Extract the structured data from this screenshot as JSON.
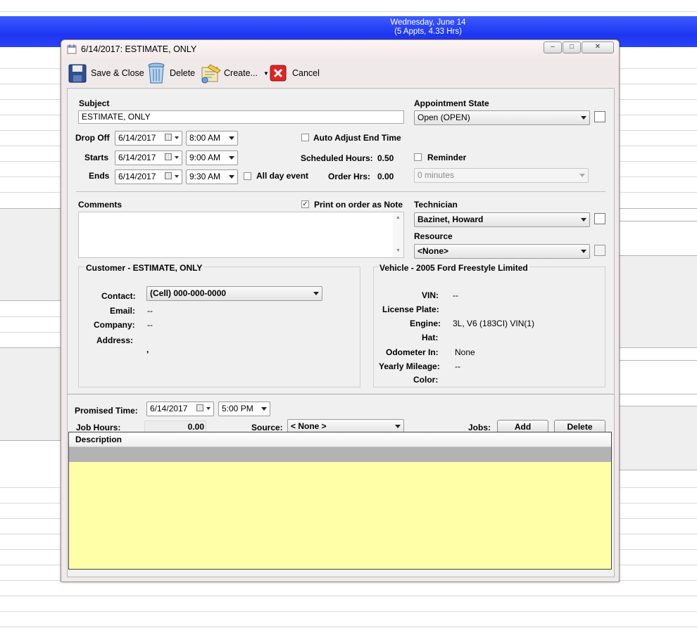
{
  "calendar": {
    "day_heading": "Wednesday, June 14",
    "day_summary": "(5 Appts, 4.33 Hrs)"
  },
  "window": {
    "title": "6/14/2017: ESTIMATE, ONLY",
    "min": "–",
    "max": "□",
    "close": "✕"
  },
  "toolbar": {
    "save_close": "Save & Close",
    "delete": "Delete",
    "create": "Create...",
    "cancel": "Cancel"
  },
  "form": {
    "subject_label": "Subject",
    "subject_value": "ESTIMATE, ONLY",
    "appt_state_label": "Appointment State",
    "appt_state_value": "Open (OPEN)",
    "dropoff_label": "Drop Off",
    "dropoff_date": "6/14/2017",
    "dropoff_time": "8:00 AM",
    "auto_adjust_label": "Auto Adjust End Time",
    "starts_label": "Starts",
    "starts_date": "6/14/2017",
    "starts_time": "9:00 AM",
    "sched_hours_label": "Scheduled Hours:",
    "sched_hours_value": "0.50",
    "reminder_label": "Reminder",
    "ends_label": "Ends",
    "ends_date": "6/14/2017",
    "ends_time": "9:30 AM",
    "all_day_label": "All day event",
    "order_hrs_label": "Order Hrs:",
    "order_hrs_value": "0.00",
    "reminder_value": "0 minutes",
    "comments_label": "Comments",
    "print_note_label": "Print on order as Note",
    "check_mark": "✓",
    "technician_label": "Technician",
    "technician_value": "Bazinet, Howard",
    "resource_label": "Resource",
    "resource_value": "<None>"
  },
  "customer": {
    "heading": "Customer - ESTIMATE, ONLY",
    "contact_label": "Contact:",
    "contact_value": "(Cell)  000-000-0000",
    "email_label": "Email:",
    "email_value": "--",
    "company_label": "Company:",
    "company_value": "--",
    "address_label": "Address:",
    "address_value": ","
  },
  "vehicle": {
    "heading": "Vehicle - 2005 Ford Freestyle Limited",
    "vin_label": "VIN:",
    "vin_value": "--",
    "plate_label": "License Plate:",
    "engine_label": "Engine:",
    "engine_value": "3L, V6 (183CI) VIN(1)",
    "hat_label": "Hat:",
    "odometer_label": "Odometer In:",
    "odometer_value": "None",
    "mileage_label": "Yearly Mileage:",
    "mileage_value": "--",
    "color_label": "Color:"
  },
  "bottom": {
    "promised_label": "Promised Time:",
    "promised_date": "6/14/2017",
    "promised_time": "5:00 PM",
    "job_hours_label": "Job Hours:",
    "job_hours_value": "0.00",
    "source_label": "Source:",
    "source_value": "< None >",
    "jobs_label": "Jobs:",
    "add_button": "Add",
    "delete_button": "Delete",
    "grid_header": "Description"
  }
}
